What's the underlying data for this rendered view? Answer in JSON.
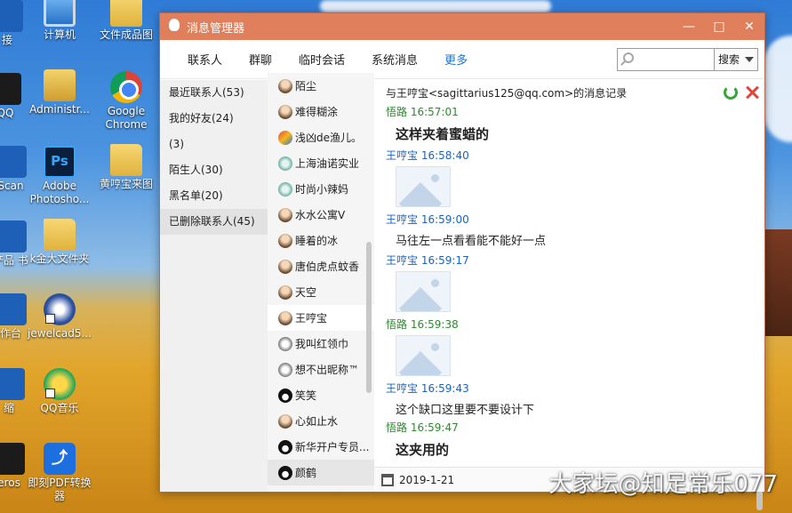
{
  "desktop": {
    "icons": [
      {
        "label": "接",
        "icon": "network-icon"
      },
      {
        "label": "计算机",
        "icon": "computer-icon"
      },
      {
        "label": "文件成品图",
        "icon": "folder-icon"
      },
      {
        "label": "QQ",
        "icon": "qq-icon"
      },
      {
        "label": "Administr...",
        "icon": "user-folder-icon"
      },
      {
        "label": "Google Chrome",
        "icon": "chrome-icon"
      },
      {
        "label": "Scan",
        "icon": "scan-icon"
      },
      {
        "label": "Adobe Photosho...",
        "icon": "photoshop-icon"
      },
      {
        "label": "黄哼宝来图",
        "icon": "folder-icon"
      },
      {
        "label": "产品 书",
        "icon": "app-icon"
      },
      {
        "label": "k金大文件夹",
        "icon": "folder-icon"
      },
      {
        "label": "作台",
        "icon": "app-icon"
      },
      {
        "label": "jewelcad5...",
        "icon": "jewelcad-icon"
      },
      {
        "label": "缩",
        "icon": "app-icon"
      },
      {
        "label": "QQ音乐",
        "icon": "qq-music-icon"
      },
      {
        "label": "eros",
        "icon": "app-icon"
      },
      {
        "label": "即刻PDF转换 器",
        "icon": "pdf-converter-icon"
      }
    ]
  },
  "window": {
    "title": "消息管理器",
    "controls": {
      "minimize": "—",
      "maximize": "□",
      "close": "✕"
    }
  },
  "toolbar": {
    "tabs": [
      {
        "label": "联系人"
      },
      {
        "label": "群聊"
      },
      {
        "label": "临时会话"
      },
      {
        "label": "系统消息"
      },
      {
        "label": "更多"
      }
    ],
    "search": {
      "button_label": "搜索",
      "value": ""
    }
  },
  "groups": [
    {
      "label": "最近联系人(53)"
    },
    {
      "label": "我的好友(24)"
    },
    {
      "label": "(3)"
    },
    {
      "label": "陌生人(30)"
    },
    {
      "label": "黑名单(20)"
    },
    {
      "label": "已删除联系人(45)"
    }
  ],
  "contacts": [
    {
      "name": "陌尘",
      "avatar": "person"
    },
    {
      "name": "难得糊涂",
      "avatar": "person"
    },
    {
      "name": "浅凶de渔儿。",
      "avatar": "pic"
    },
    {
      "name": "上海油诺实业",
      "avatar": "teal"
    },
    {
      "name": "时尚小辣妈",
      "avatar": "teal"
    },
    {
      "name": "水水公寓V",
      "avatar": "person"
    },
    {
      "name": "睡着的冰",
      "avatar": "person"
    },
    {
      "name": "唐伯虎点蚊香",
      "avatar": "person"
    },
    {
      "name": "天空",
      "avatar": "person"
    },
    {
      "name": "王哼宝",
      "avatar": "person"
    },
    {
      "name": "我叫红领巾",
      "avatar": "grey"
    },
    {
      "name": "想不出昵称™",
      "avatar": "grey"
    },
    {
      "name": "笑笑",
      "avatar": "penguin"
    },
    {
      "name": "心如止水",
      "avatar": "person"
    },
    {
      "name": "新华开户专员...",
      "avatar": "penguin"
    },
    {
      "name": "颜鹤",
      "avatar": "penguin"
    }
  ],
  "chat": {
    "header": "与王哼宝<sagittarius125@qq.com>的消息记录",
    "messages": [
      {
        "sender": "悟路",
        "time": "16:57:01",
        "side": "me",
        "text": "这样夹着蜜蜡的",
        "big": true
      },
      {
        "sender": "王哼宝",
        "time": "16:58:40",
        "side": "peer",
        "image": true
      },
      {
        "sender": "王哼宝",
        "time": "16:59:00",
        "side": "peer",
        "text": "马往左一点看看能不能好一点"
      },
      {
        "sender": "王哼宝",
        "time": "16:59:17",
        "side": "peer",
        "image": true
      },
      {
        "sender": "悟路",
        "time": "16:59:38",
        "side": "me",
        "image": true
      },
      {
        "sender": "王哼宝",
        "time": "16:59:43",
        "side": "peer",
        "text": "这个缺口这里要不要设计下"
      },
      {
        "sender": "悟路",
        "time": "16:59:47",
        "side": "me",
        "text": "这夹用的",
        "big": true
      }
    ],
    "date": "2019-1-21"
  },
  "watermark": "大家坛@知足常乐077"
}
